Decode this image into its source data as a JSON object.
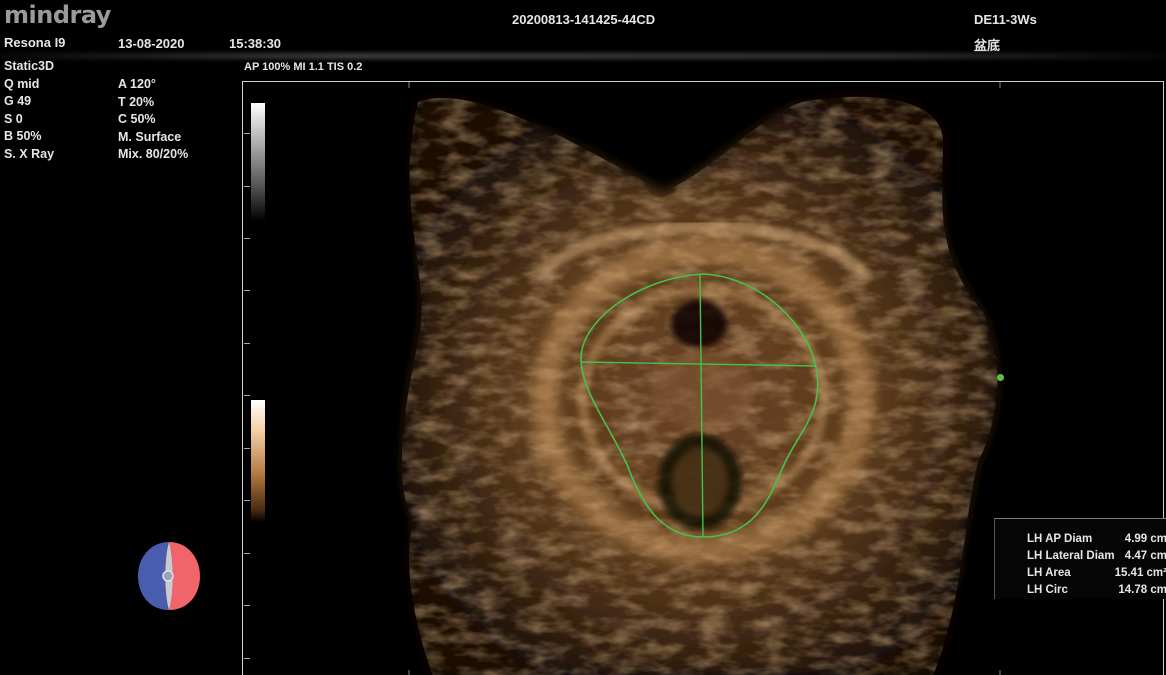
{
  "header": {
    "brand": "mindray",
    "device": "Resona I9",
    "date": "13-08-2020",
    "time": "15:38:30",
    "exam_id": "20200813-141425-44CD",
    "probe": "DE11-3Ws",
    "preset": "盆底"
  },
  "acoustic": "AP 100%  MI 1.1 TIS 0.2",
  "params_left": [
    "Static3D",
    "Q mid",
    "G 49",
    "S 0",
    "B 50%",
    "S. X Ray"
  ],
  "params_right": [
    "A 120°",
    "T 20%",
    "C 50%",
    "M. Surface",
    "Mix. 80/20%"
  ],
  "measurements": [
    {
      "label": "LH AP Diam",
      "value": "4.99 cm"
    },
    {
      "label": "LH Lateral Diam",
      "value": "4.47 cm"
    },
    {
      "label": "LH Area",
      "value": "15.41 cm²"
    },
    {
      "label": "LH Circ",
      "value": "14.78 cm"
    }
  ],
  "colors": {
    "trace": "#46c24a",
    "tissue": "#b67a42",
    "orient_left": "#4a5cb0",
    "orient_right": "#f0646a"
  }
}
